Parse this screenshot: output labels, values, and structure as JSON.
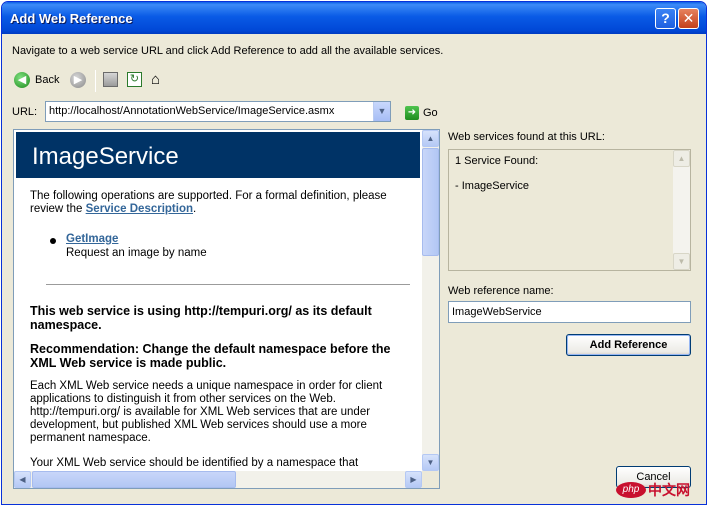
{
  "window": {
    "title": "Add Web Reference",
    "help_glyph": "?",
    "close_glyph": "✕"
  },
  "instruction": "Navigate to a web service URL and click Add Reference to add all the available services.",
  "toolbar": {
    "back_label": "Back"
  },
  "url": {
    "label": "URL:",
    "value": "http://localhost/AnnotationWebService/ImageService.asmx",
    "go_label": "Go"
  },
  "browser": {
    "service_title": "ImageService",
    "intro_text": "The following operations are supported. For a formal definition, please review the",
    "service_description_link": "Service Description",
    "operation": {
      "name": "GetImage",
      "description": "Request an image by name"
    },
    "namespace_heading": "This web service is using http://tempuri.org/ as its default namespace.",
    "recommendation_heading": "Recommendation: Change the default namespace before the XML Web service is made public.",
    "paragraph1": "Each XML Web service needs a unique namespace in order for client applications to distinguish it from other services on the Web. http://tempuri.org/ is available for XML Web services that are under development, but published XML Web services should use a more permanent namespace.",
    "paragraph2": "Your XML Web service should be identified by a namespace that"
  },
  "services_panel": {
    "label": "Web services found at this URL:",
    "count_text": "1 Service Found:",
    "service_item": "- ImageService"
  },
  "reference": {
    "label": "Web reference name:",
    "value": "ImageWebService"
  },
  "buttons": {
    "add_reference": "Add Reference",
    "cancel": "Cancel"
  },
  "watermark": {
    "logo": "php",
    "text": "中文网"
  }
}
